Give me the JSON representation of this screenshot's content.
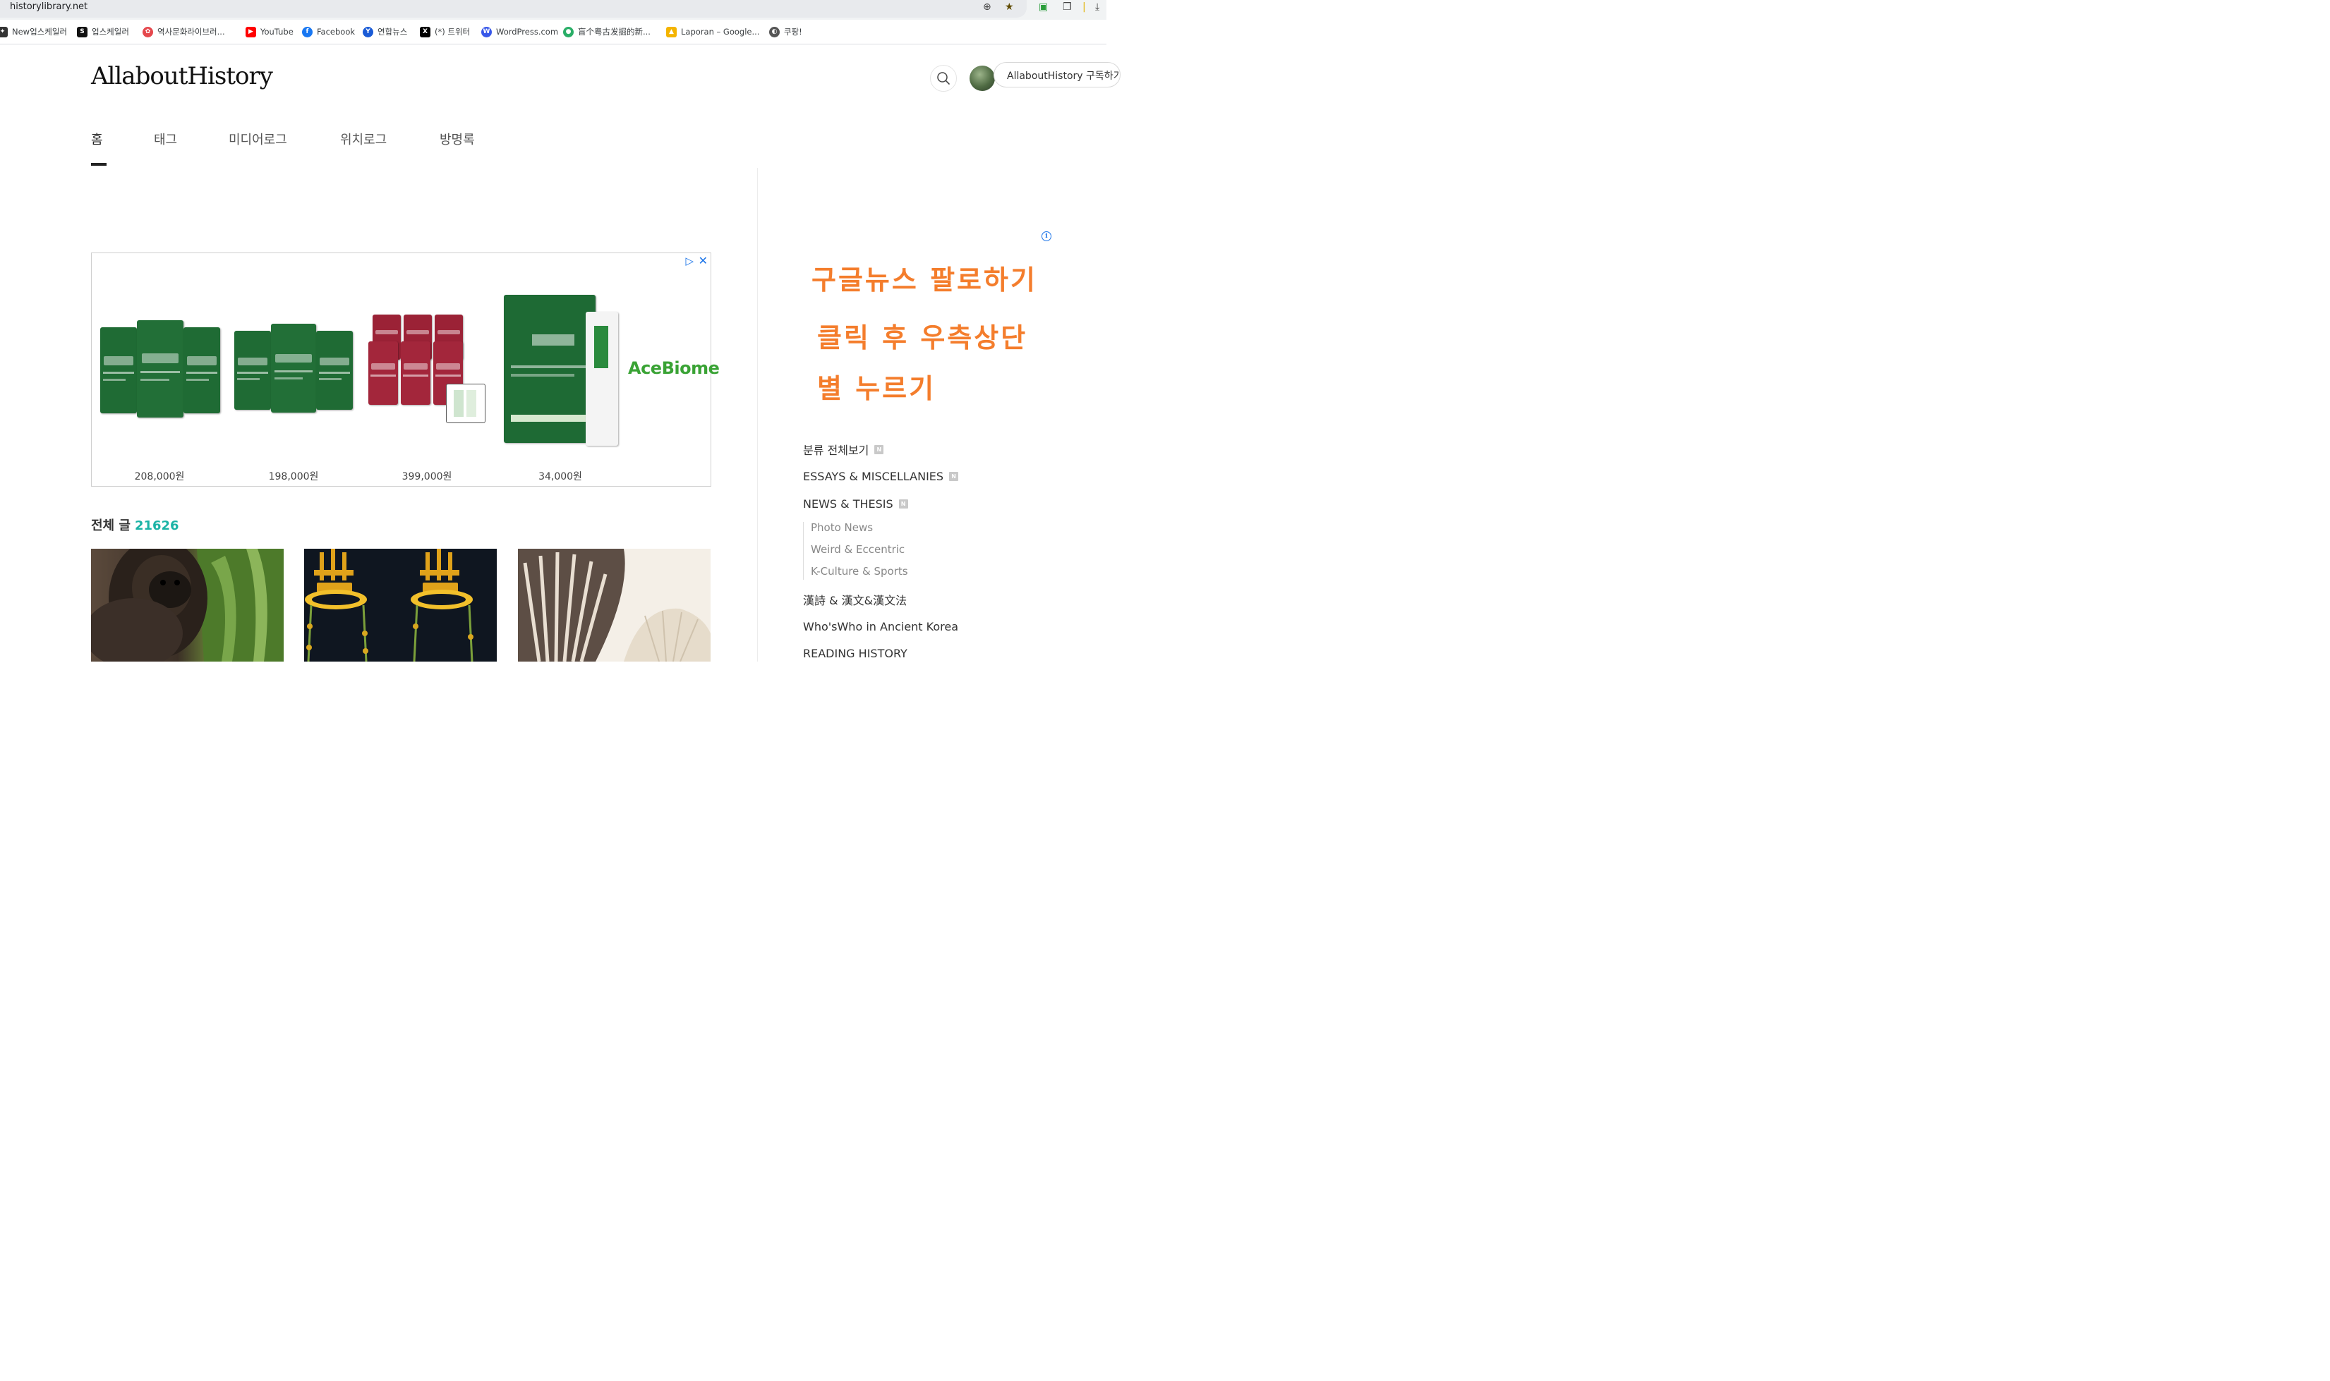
{
  "browser": {
    "url": "historylibrary.net",
    "bookmarks": [
      {
        "label": "New업스케일러",
        "color": "#333333",
        "glyph": "✦"
      },
      {
        "label": "업스케일러",
        "color": "#111111",
        "glyph": "S"
      },
      {
        "label": "역사문화라이브러...",
        "color": "#e5484d",
        "glyph": "✿"
      },
      {
        "label": "YouTube",
        "color": "#ff0000",
        "glyph": "▶"
      },
      {
        "label": "Facebook",
        "color": "#1877f2",
        "glyph": "f"
      },
      {
        "label": "연합뉴스",
        "color": "#1a5bd6",
        "glyph": "Y"
      },
      {
        "label": "(*) 트위터",
        "color": "#000000",
        "glyph": "X"
      },
      {
        "label": "WordPress.com",
        "color": "#3858e9",
        "glyph": "W"
      },
      {
        "label": "盲个粤古发掘的新...",
        "color": "#2aae67",
        "glyph": "●"
      },
      {
        "label": "Laporan – Google...",
        "color": "#f4b400",
        "glyph": "▲"
      },
      {
        "label": "쿠팡!",
        "color": "#555555",
        "glyph": "◐"
      }
    ]
  },
  "header": {
    "logo": "AllaboutHistory",
    "subscribe_label": "AllaboutHistory 구독하기"
  },
  "nav": {
    "items": [
      {
        "label": "홈"
      },
      {
        "label": "태그"
      },
      {
        "label": "미디어로그"
      },
      {
        "label": "위치로그"
      },
      {
        "label": "방명록"
      }
    ]
  },
  "ad": {
    "brand": "AceBiome",
    "prices": [
      "208,000원",
      "198,000원",
      "399,000원",
      "34,000원"
    ]
  },
  "posts": {
    "label": "전체 글",
    "count": "21626"
  },
  "sidebar": {
    "promo_lines": [
      "구글뉴스 팔로하기",
      "클릭 후 우측상단",
      "별 누르기"
    ],
    "categories": [
      {
        "label": "분류 전체보기",
        "badge": "N"
      },
      {
        "label": "ESSAYS & MISCELLANIES",
        "badge": "N"
      },
      {
        "label": "NEWS & THESIS",
        "badge": "N"
      },
      {
        "label": "漢詩 & 漢文&漢文法",
        "badge": ""
      },
      {
        "label": "Who'sWho in Ancient Korea",
        "badge": ""
      },
      {
        "label": "READING HISTORY",
        "badge": ""
      }
    ],
    "subcategories": [
      {
        "label": "Photo News"
      },
      {
        "label": "Weird & Eccentric"
      },
      {
        "label": "K-Culture & Sports"
      }
    ]
  },
  "colors": {
    "accent_teal": "#1bb3a6",
    "promo_orange": "#f47d2c",
    "ad_green": "#3aa335"
  }
}
